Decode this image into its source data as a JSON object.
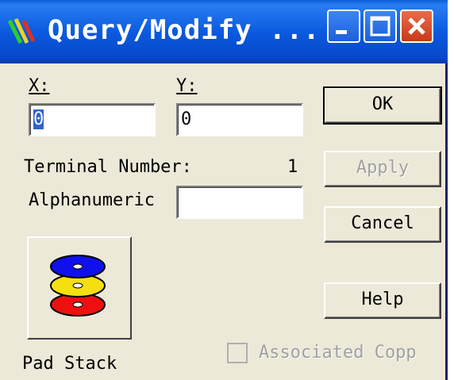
{
  "window": {
    "title": "Query/Modify ...",
    "icon": "app-icon",
    "controls": [
      "minimize-icon",
      "maximize-icon",
      "close-icon"
    ]
  },
  "fields": {
    "x_label": "X:",
    "x_value": "0",
    "y_label": "Y:",
    "y_value": "0",
    "terminal_label": "Terminal Number:",
    "terminal_value": "1",
    "alphanumeric_label": "Alphanumeric",
    "alphanumeric_value": ""
  },
  "buttons": {
    "ok": "OK",
    "apply": "Apply",
    "cancel": "Cancel",
    "help": "Help"
  },
  "pad_stack": {
    "label": "Pad Stack",
    "icon": "pad-stack-icon"
  },
  "checkbox": {
    "label": "Associated Copp",
    "checked": false,
    "enabled": false
  }
}
